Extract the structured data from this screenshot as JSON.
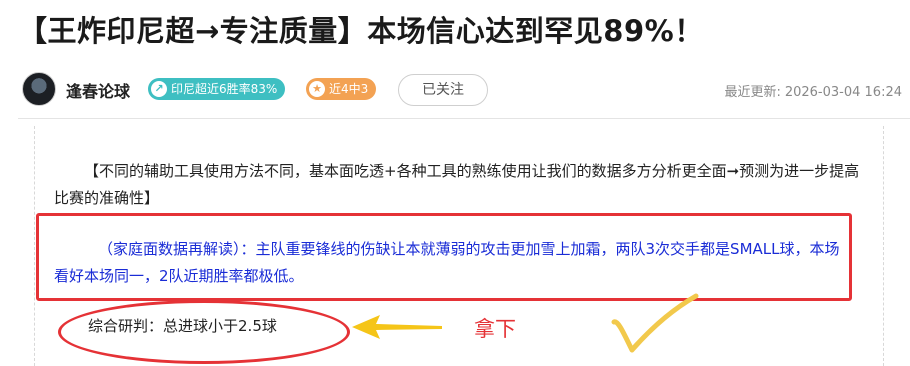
{
  "article": {
    "title": "【王炸印尼超→专注质量】本场信心达到罕见89%！",
    "author": "逢春论球",
    "badges": [
      {
        "icon": "up-arrow-icon",
        "label": "印尼超近6胜率83%",
        "color": "#3ebfc2"
      },
      {
        "icon": "star-icon",
        "label": "近4中3",
        "color": "#f3a253"
      }
    ],
    "follow_label": "已关注",
    "updated_label": "最近更新:",
    "updated_time": "2026-03-04 16:24",
    "paragraph1": "【不同的辅助工具使用方法不同，基本面吃透+各种工具的熟练使用让我们的数据多方分析更全面➞预测为进一步提高比赛的准确性】",
    "paragraph2": "（家庭面数据再解读）：主队重要锋线的伤缺让本就薄弱的攻击更加雪上加霜，两队3次交手都是SMALL球，本场看好本场同一，2队近期胜率都极低。",
    "conclusion": "综合研判：总进球小于2.5球",
    "result_mark": "拿下"
  },
  "colors": {
    "annotation_red": "#e53236",
    "highlight_blue": "#1a2cd6",
    "arrow_yellow": "#f5c518",
    "check_yellow": "#f2c94c"
  }
}
